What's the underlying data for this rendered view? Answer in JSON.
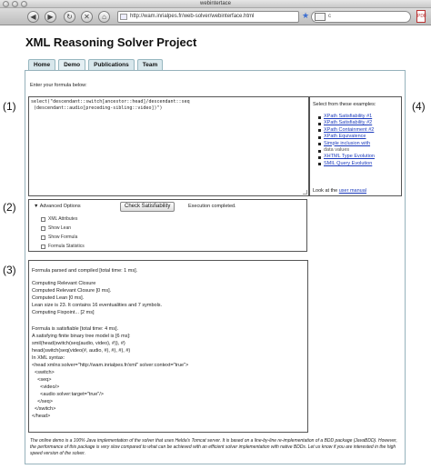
{
  "browser": {
    "window_title": "webintertace",
    "address": "http://wam.inrialpes.fr/web-solver/webinterface.html",
    "search": "c"
  },
  "page": {
    "title": "XML Reasoning Solver Project",
    "tabs": [
      "Home",
      "Demo",
      "Publications",
      "Team"
    ],
    "active_tab": "Demo"
  },
  "callouts": [
    "(1)",
    "(2)",
    "(3)",
    "(4)"
  ],
  "formula": {
    "label": "Enter your formula below:",
    "text": "select(\"descendant::switch[ancestor::head]/descendant::seq\n (descendant::audio[preceding-sibling::video])\")"
  },
  "examples": {
    "title": "Select from these examples:",
    "items": [
      "XPath Satisfiability #1",
      "XPath Satisfiability #2",
      "XPath Containment #2",
      "XPath Equivalence",
      "Simple inclusion with",
      "data values",
      "XHTML Type Evolution",
      "SMIL Query Evolution"
    ],
    "footer_prefix": "Look at the",
    "footer_link": "user manual"
  },
  "options": {
    "advanced_label": "Advanced Options",
    "check_button": "Check Satisfiability",
    "status": "Execution completed.",
    "items": [
      "XML Attributes",
      "Show Lean",
      "Show Formula",
      "Formula Statistics"
    ]
  },
  "output": {
    "lines": [
      "Formula parsed and compiled [total time: 1 ms].",
      "",
      "Computing Relevant Closure",
      "Computed Relevant Closure [0 ms].",
      "Computed Lean [0 ms].",
      "Lean size is 23. It contains 16 eventualities and 7 symbols.",
      "Computing Fixpoint... [2 ms]",
      "",
      "Formula is satisfiable [total time: 4 ms].",
      "A satisfying finite binary tree model is [6 ms]:",
      "smil(head(switch(seq(audio, video), #)), #)",
      "head(switch(seq(video(#, audio, #), #), #), #)",
      "In XML syntax:",
      "<head xmlns:solver=\"http://wam.inrialpes.fr/xml\" solver:context=\"true\">",
      "  <switch>",
      "    <seq>",
      "      <video/>",
      "      <audio solver:target=\"true\"/>",
      "    </seq>",
      "  </switch>",
      "</head>"
    ]
  },
  "notice": "The online demo is a 100% Java implementation of the solver that uses Helda's Tomcat server. It is based on a line-by-line re-implementation of a BDD package (JavaBDD). However, the performance of this package is very slow compared to what can be achieved with an efficient solver implementation with native BDDs. Let us know if you are interested in the high speed version of the solver."
}
